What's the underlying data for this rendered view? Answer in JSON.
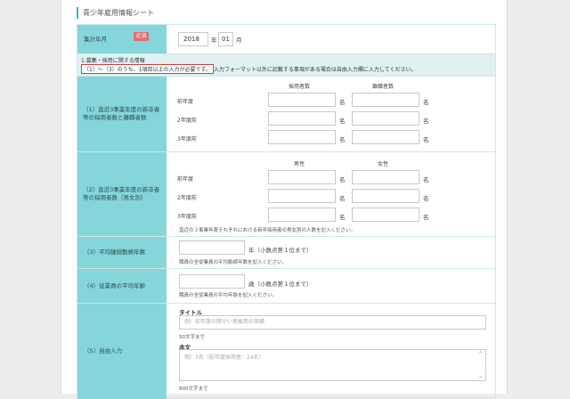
{
  "sheet_title": "青少年雇用情報シート",
  "period": {
    "label": "集計年月",
    "required_badge": "必須",
    "year": "2018",
    "year_unit": "年",
    "month": "01",
    "month_unit": "月"
  },
  "notice": {
    "line1": "1.募集・採用に関する情報",
    "line2_highlight": "（1）～（3）のうち、1項目以上の入力が必要です。",
    "line2_rest": "入力フォーマット以外に記載する事項がある場合は自由入力欄に入力してください。"
  },
  "section1": {
    "label": "（1）直近3事業年度の新卒者等の採用者数と離職者数",
    "col1": "採用者数",
    "col2": "離職者数",
    "rows": [
      "前年度",
      "2年度前",
      "3年度前"
    ],
    "unit": "名"
  },
  "section2": {
    "label": "（2）直近3事業年度の新卒者等の採用者数（男女別）",
    "col1": "男性",
    "col2": "女性",
    "rows": [
      "前年度",
      "2年度前",
      "3年度前"
    ],
    "unit": "名",
    "note": "直近の３事業年度それぞれにおける新卒採用者の男女別の人数を記入ください。"
  },
  "section3": {
    "label": "（3）平均継続勤務年数",
    "unit": "年（小数点第１位まで）",
    "note": "職員の全従業員の平均勤続年数を記入ください。"
  },
  "section4": {
    "label": "（4）従業員の平均年齢",
    "unit": "歳（小数点第１位まで）",
    "note": "職員の全従業員の平均年齢を記入ください。"
  },
  "section5": {
    "label": "（5）自由入力",
    "title_label": "タイトル",
    "title_placeholder": "例）前年度の障がい者雇用の実績",
    "title_limit": "50文字まで",
    "body_label": "本文",
    "body_placeholder": "例）3名（前年度採用者：24名）",
    "body_limit": "800文字まで"
  },
  "colors": {
    "label_bg": "#84d6db",
    "notice_bg": "#dff1f3",
    "required": "#e06d75",
    "accent": "#3bb8c4"
  }
}
